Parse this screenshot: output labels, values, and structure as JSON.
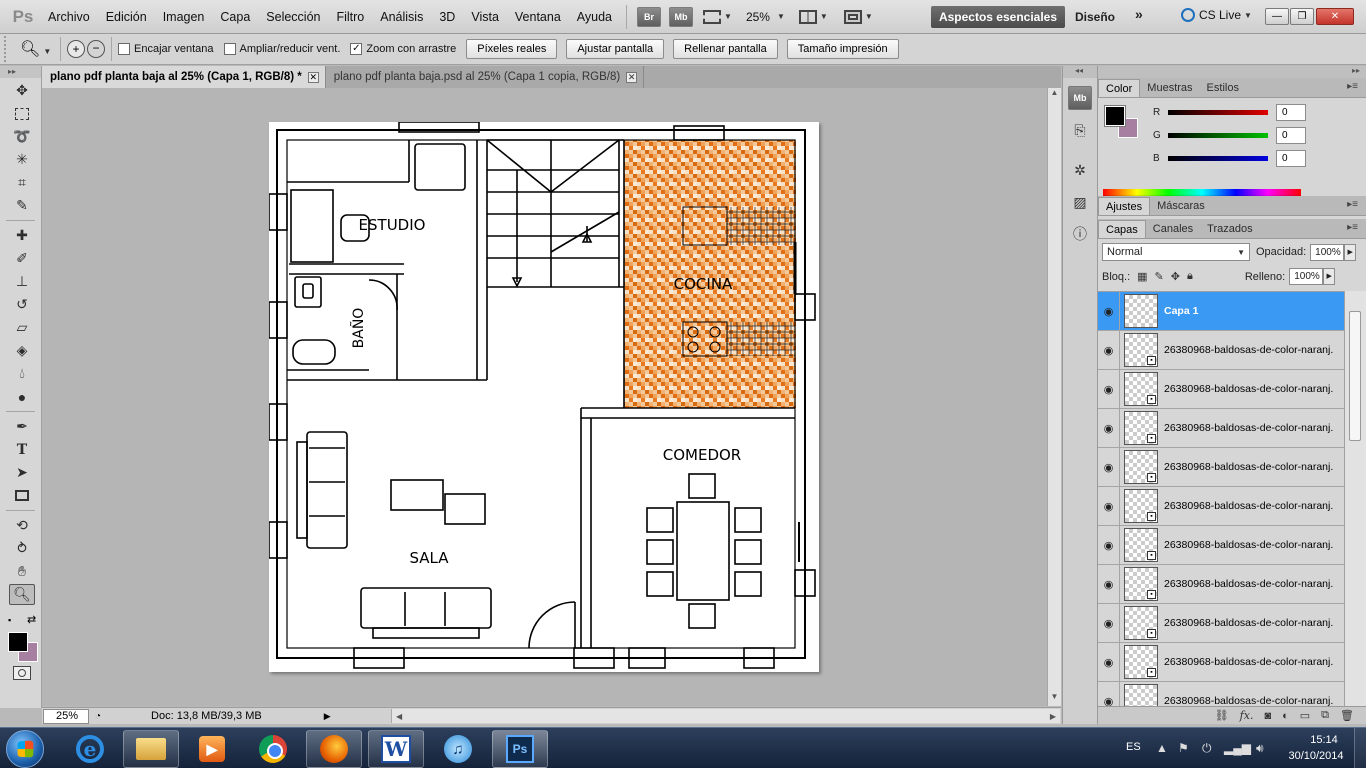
{
  "app": {
    "logo": "Ps"
  },
  "menubar": {
    "items": [
      "Archivo",
      "Edición",
      "Imagen",
      "Capa",
      "Selección",
      "Filtro",
      "Análisis",
      "3D",
      "Vista",
      "Ventana",
      "Ayuda"
    ],
    "bridge_btn": "Br",
    "minibridge_btn": "Mb",
    "zoom_level": "25%",
    "workspace_active": "Aspectos esenciales",
    "workspace_other": "Diseño",
    "workspace_more": "»",
    "cs_live": "CS Live"
  },
  "options": {
    "fit_window": "Encajar ventana",
    "resize_window": "Ampliar/reducir vent.",
    "scrubby_zoom": "Zoom con arrastre",
    "btn_actual_pixels": "Píxeles reales",
    "btn_fit_screen": "Ajustar pantalla",
    "btn_fill_screen": "Rellenar pantalla",
    "btn_print_size": "Tamaño impresión"
  },
  "tabs": [
    {
      "label": "plano pdf planta baja al 25% (Capa 1, RGB/8) *"
    },
    {
      "label": "plano pdf planta baja.psd al 25% (Capa 1 copia, RGB/8)"
    }
  ],
  "plan": {
    "rooms": [
      "ESTUDIO",
      "BAÑO",
      "COCINA",
      "COMEDOR",
      "SALA"
    ]
  },
  "status": {
    "zoom": "25%",
    "doc_info": "Doc: 13,8 MB/39,3 MB"
  },
  "color_panel": {
    "tabs": [
      "Color",
      "Muestras",
      "Estilos"
    ],
    "channels": [
      {
        "label": "R",
        "value": "0",
        "color": "#e00000"
      },
      {
        "label": "G",
        "value": "0",
        "color": "#00c000"
      },
      {
        "label": "B",
        "value": "0",
        "color": "#0000e0"
      }
    ],
    "foreground": "#000000",
    "background": "#a67fa1"
  },
  "adjust_panel": {
    "tabs": [
      "Ajustes",
      "Máscaras"
    ]
  },
  "layers_panel": {
    "tabs": [
      "Capas",
      "Canales",
      "Trazados"
    ],
    "blend_mode": "Normal",
    "opacity_label": "Opacidad:",
    "opacity_value": "100%",
    "lock_label": "Bloq.:",
    "fill_label": "Relleno:",
    "fill_value": "100%",
    "layers": [
      {
        "name": "Capa 1",
        "selected": true
      },
      {
        "name": "26380968-baldosas-de-color-naranj..."
      },
      {
        "name": "26380968-baldosas-de-color-naranj..."
      },
      {
        "name": "26380968-baldosas-de-color-naranj..."
      },
      {
        "name": "26380968-baldosas-de-color-naranj..."
      },
      {
        "name": "26380968-baldosas-de-color-naranj..."
      },
      {
        "name": "26380968-baldosas-de-color-naranj..."
      },
      {
        "name": "26380968-baldosas-de-color-naranj..."
      },
      {
        "name": "26380968-baldosas-de-color-naranj..."
      },
      {
        "name": "26380968-baldosas-de-color-naranj..."
      },
      {
        "name": "26380968-baldosas-de-color-naranj..."
      }
    ]
  },
  "taskbar": {
    "language": "ES",
    "time": "15:14",
    "date": "30/10/2014"
  }
}
